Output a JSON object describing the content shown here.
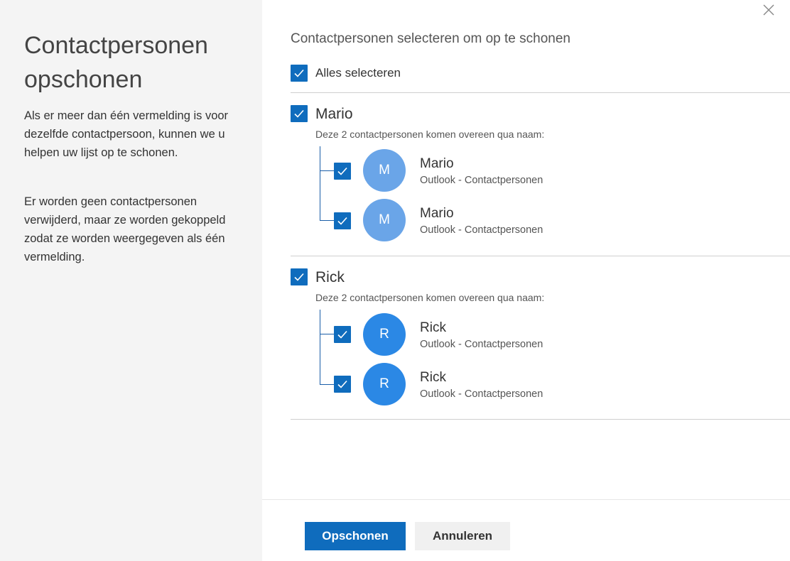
{
  "sidebar": {
    "title": "Contactpersonen opschonen",
    "paragraph1": "Als er meer dan één vermelding is voor dezelfde contactpersoon, kunnen we u helpen uw lijst op te schonen.",
    "paragraph2": "Er worden geen contactpersonen verwijderd, maar ze worden gekoppeld zodat ze worden weergegeven als één vermelding."
  },
  "main": {
    "heading": "Contactpersonen selecteren om op te schonen",
    "select_all_label": "Alles selecteren",
    "groups": [
      {
        "name": "Mario",
        "subtitle": "Deze 2 contactpersonen komen overeen qua naam:",
        "contacts": [
          {
            "initial": "M",
            "name": "Mario",
            "source": "Outlook - Contactpersonen"
          },
          {
            "initial": "M",
            "name": "Mario",
            "source": "Outlook - Contactpersonen"
          }
        ]
      },
      {
        "name": "Rick",
        "subtitle": "Deze 2 contactpersonen komen overeen qua naam:",
        "contacts": [
          {
            "initial": "R",
            "name": "Rick",
            "source": "Outlook - Contactpersonen"
          },
          {
            "initial": "R",
            "name": "Rick",
            "source": "Outlook - Contactpersonen"
          }
        ]
      }
    ]
  },
  "footer": {
    "primary_label": "Opschonen",
    "secondary_label": "Annuleren"
  },
  "icons": {
    "close": "close-icon",
    "checkbox": "checkmark-icon"
  },
  "colors": {
    "accent": "#0f6cbd",
    "avatar_mario": "#6aa5e8",
    "avatar_rick": "#2b88e5",
    "sidebar_bg": "#f4f4f4"
  }
}
